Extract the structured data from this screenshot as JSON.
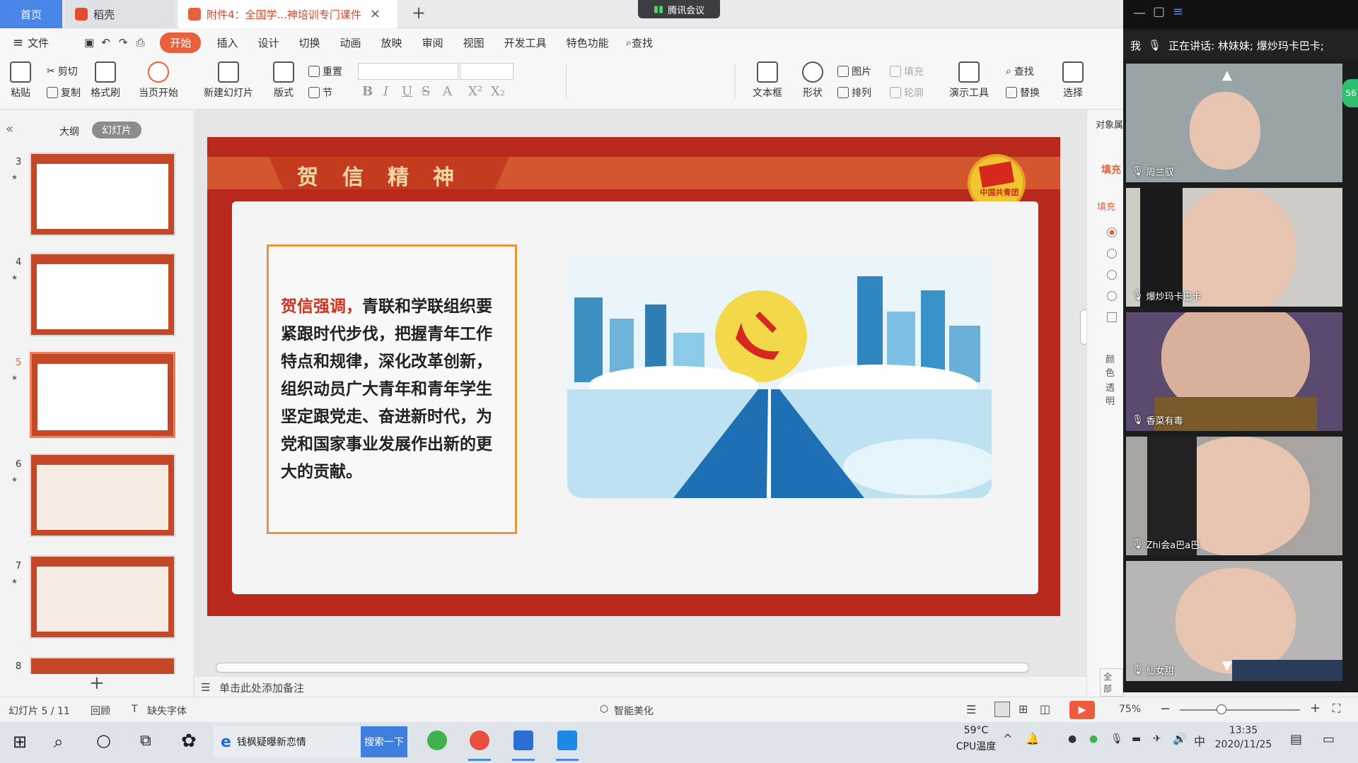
{
  "tabs": {
    "home": "首页",
    "daoke": "稻壳",
    "doc": "附件4：全国学...神培训专门课件",
    "new_tab": "+"
  },
  "meeting_app": {
    "title": "腾讯会议"
  },
  "menu": {
    "file": "文件",
    "items": [
      "开始",
      "插入",
      "设计",
      "切换",
      "动画",
      "放映",
      "审阅",
      "视图",
      "开发工具",
      "特色功能"
    ],
    "search": "查找"
  },
  "ribbon": {
    "paste": "粘贴",
    "cut": "剪切",
    "copy": "复制",
    "format_painter": "格式刷",
    "from_current": "当页开始",
    "new_slide": "新建幻灯片",
    "layout": "版式",
    "reset": "重置",
    "section": "节",
    "text_box": "文本框",
    "shape": "形状",
    "picture": "图片",
    "fill": "填充",
    "arrange": "排列",
    "outline": "轮廓",
    "present_tools": "演示工具",
    "find": "查找",
    "replace": "替换",
    "select": "选择"
  },
  "left_panel": {
    "outline_tab": "大纲",
    "slides_tab": "幻灯片",
    "thumbs": [
      {
        "num": "3"
      },
      {
        "num": "4"
      },
      {
        "num": "5"
      },
      {
        "num": "6"
      },
      {
        "num": "7"
      },
      {
        "num": "8"
      }
    ],
    "add": "+"
  },
  "slide": {
    "title": "贺信精神",
    "quote_lead": "贺信强调，",
    "quote_body": "青联和学联组织要紧跟时代步伐，把握青年工作特点和规律，深化改革创新，组织动员广大青年和青年学生坚定跟党走、奋进新时代，为党和国家事业发展作出新的更大的贡献。",
    "emblem_text": "中国共青团"
  },
  "notes_placeholder": "单击此处添加备注",
  "right_panel": {
    "obj": "对象属",
    "fill_tab": "填充",
    "fill_head": "填充",
    "color": "颜色",
    "transparency": "透明",
    "all": "全部"
  },
  "meeting": {
    "self": "我",
    "speaking": "正在讲话: 林妹妹; 爆炒玛卡巴卡;",
    "participants": [
      "周兰驭",
      "爆炒玛卡巴卡",
      "香菜有毒",
      "Zhi会a巴a巴",
      "仙女甜"
    ],
    "badge": "56"
  },
  "status": {
    "slide_pos": "幻灯片 5 / 11",
    "review": "回顾",
    "missing_font": "缺失字体",
    "beautify": "智能美化",
    "zoom": "75%"
  },
  "taskbar": {
    "browser_text": "钱枫疑曝新恋情",
    "search_btn": "搜索一下",
    "temp": "59°C",
    "temp_label": "CPU温度",
    "ime": "中",
    "time": "13:35",
    "date": "2020/11/25"
  },
  "colors": {
    "accent": "#e8603c",
    "slide_red": "#b8281c",
    "quote_border": "#e89638",
    "taskbar_blue": "#4a86e8"
  }
}
